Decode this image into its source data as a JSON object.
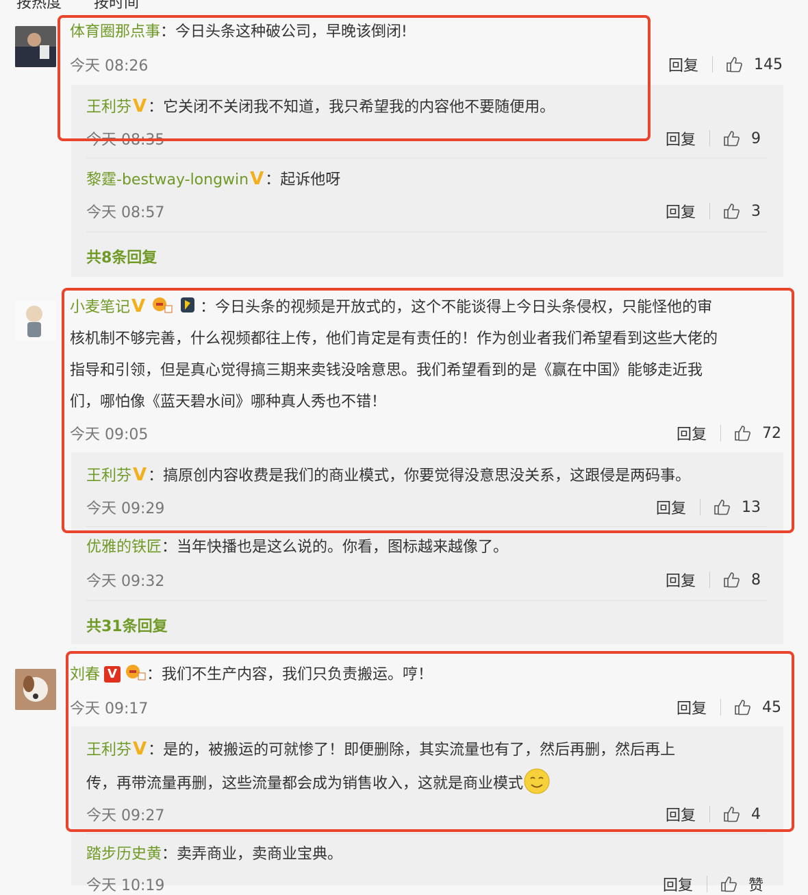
{
  "sort": {
    "by_hot": "按热度",
    "by_time": "按时间"
  },
  "colors": {
    "accent_green": "#6f9a26",
    "highlight_red": "#e8452c",
    "vip_gold": "#f2b01e"
  },
  "labels": {
    "reply": "回复"
  },
  "comments": [
    {
      "user": "体育圈那点事",
      "text": "今日头条这种破公司，早晚该倒闭!",
      "time": "今天 08:26",
      "likes": "145",
      "replies": [
        {
          "user": "王利芬",
          "text": "它关闭不关闭我不知道，我只希望我的内容他不要随便用。",
          "time": "今天 08:35",
          "likes": "9"
        },
        {
          "user": "黎霆-bestway-longwin",
          "text": "起诉他呀",
          "time": "今天 08:57",
          "likes": "3"
        }
      ],
      "more": "共8条回复"
    },
    {
      "user": "小麦笔记",
      "text_lines": [
        "今日头条的视频是开放式的，这个不能谈得上今日头条侵权，只能怪他的审",
        "核机制不够完善，什么视频都往上传，他们肯定是有责任的！作为创业者我们希望看到这些大佬的",
        "指导和引领，但是真心觉得搞三期来卖钱没啥意思。我们希望看到的是《赢在中国》能够走近我",
        "们，哪怕像《蓝天碧水间》哪种真人秀也不错！"
      ],
      "time": "今天 09:05",
      "likes": "72",
      "replies": [
        {
          "user": "王利芬",
          "text": "搞原创内容收费是我们的商业模式，你要觉得没意思没关系，这跟侵是两码事。",
          "time": "今天 09:29",
          "likes": "13"
        },
        {
          "user": "优雅的铁匠",
          "text": "当年快播也是这么说的。你看，图标越来越像了。",
          "time": "今天 09:32",
          "likes": "8"
        }
      ],
      "more": "共31条回复"
    },
    {
      "user": "刘春",
      "text": "我们不生产内容，我们只负责搬运。哼！",
      "time": "今天 09:17",
      "likes": "45",
      "replies": [
        {
          "user": "王利芬",
          "text_lines": [
            "是的，被搬运的可就惨了！即便删除，其实流量也有了，然后再删，然后再上",
            "传，再带流量再删，这些流量都会成为销售收入，这就是商业模式"
          ],
          "time": "今天 09:27",
          "likes": "4"
        },
        {
          "user": "踏步历史黄",
          "text": "卖弄商业，卖商业宝典。",
          "time": "今天 10:19",
          "likes": "赞"
        }
      ]
    }
  ]
}
